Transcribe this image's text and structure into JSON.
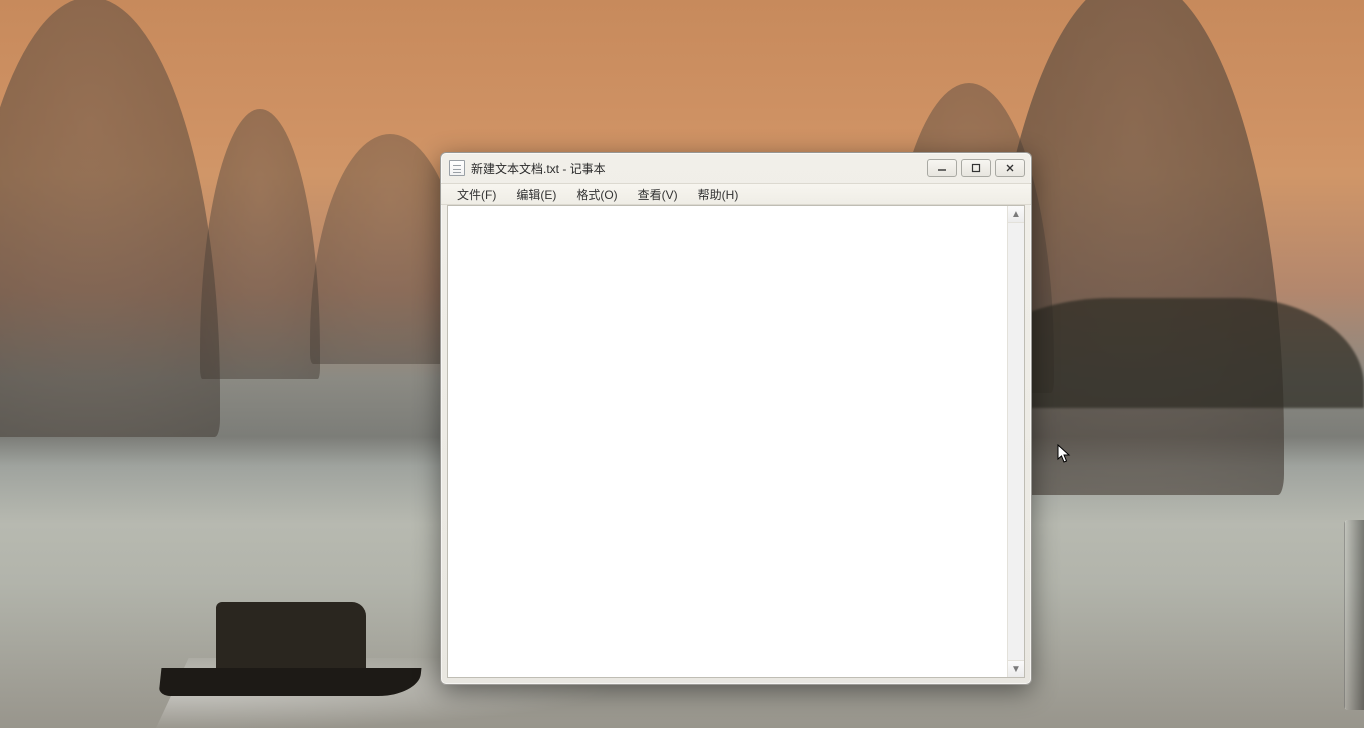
{
  "window": {
    "title": "新建文本文档.txt - 记事本",
    "content": ""
  },
  "menu": {
    "file": "文件(F)",
    "edit": "编辑(E)",
    "format": "格式(O)",
    "view": "查看(V)",
    "help": "帮助(H)"
  }
}
